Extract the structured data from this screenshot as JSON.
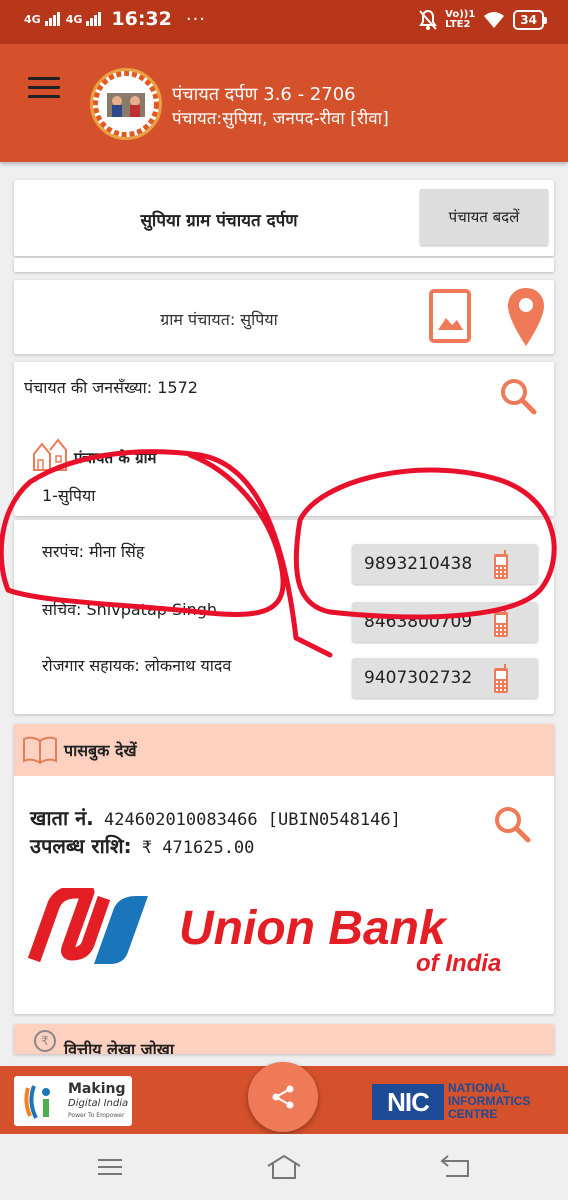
{
  "status_bar": {
    "network1": "4G",
    "network2": "4G",
    "time": "16:32",
    "more": "···",
    "volte": "Vo))",
    "sim": "1",
    "lte": "LTE2",
    "battery": "34"
  },
  "app_bar": {
    "title": "पंचायत दर्पण 3.6 - 2706",
    "subtitle": "पंचायत:सुपिया, जनपद-रीवा [रीवा]"
  },
  "header_card": {
    "title": "सुपिया ग्राम पंचायत दर्पण",
    "change_button": "पंचायत बदलें"
  },
  "gp_card": {
    "name": "ग्राम पंचायत: सुपिया"
  },
  "info_card": {
    "population": "पंचायत की जनसँख्या: 1572",
    "villages_heading": "पंचायत के ग्राम",
    "villages": [
      "1-सुपिया"
    ]
  },
  "officials": [
    {
      "label": "सरपंच: मीना  सिंह",
      "phone": "9893210438"
    },
    {
      "label": "सचिव: Shivpatap Singh",
      "phone": "8463800709"
    },
    {
      "label": "रोजगार सहायक: लोकनाथ  यादव",
      "phone": "9407302732"
    }
  ],
  "passbook": {
    "heading": "पासबुक देखें",
    "account_label": "खाता नं.",
    "account_value": "424602010083466 [UBIN0548146]",
    "balance_label": "उपलब्ध राशि:",
    "balance_value": "₹ 471625.00",
    "bank_name": "Union Bank",
    "bank_sub": "of India"
  },
  "next_section": {
    "label": "वित्तीय लेखा जोखा"
  },
  "footer": {
    "di_making": "Making",
    "di_digital": "Digital India",
    "di_tag": "Power To Empower",
    "nic_logo": "NIC",
    "nic_text": "NATIONAL INFORMATICS CENTRE"
  },
  "colors": {
    "status_bar": "#b8361a",
    "primary": "#d4512b",
    "accent": "#ef7a57",
    "section_bg": "#fdd0c0",
    "annotation": "#e8102a",
    "union_red": "#e31e24",
    "union_blue": "#1b75bb"
  },
  "icons": [
    "menu-icon",
    "image-icon",
    "location-pin-icon",
    "search-icon",
    "village-icon",
    "mobile-phone-icon",
    "book-icon",
    "rupee-icon",
    "share-icon",
    "nav-menu-icon",
    "nav-home-icon",
    "nav-back-icon"
  ]
}
